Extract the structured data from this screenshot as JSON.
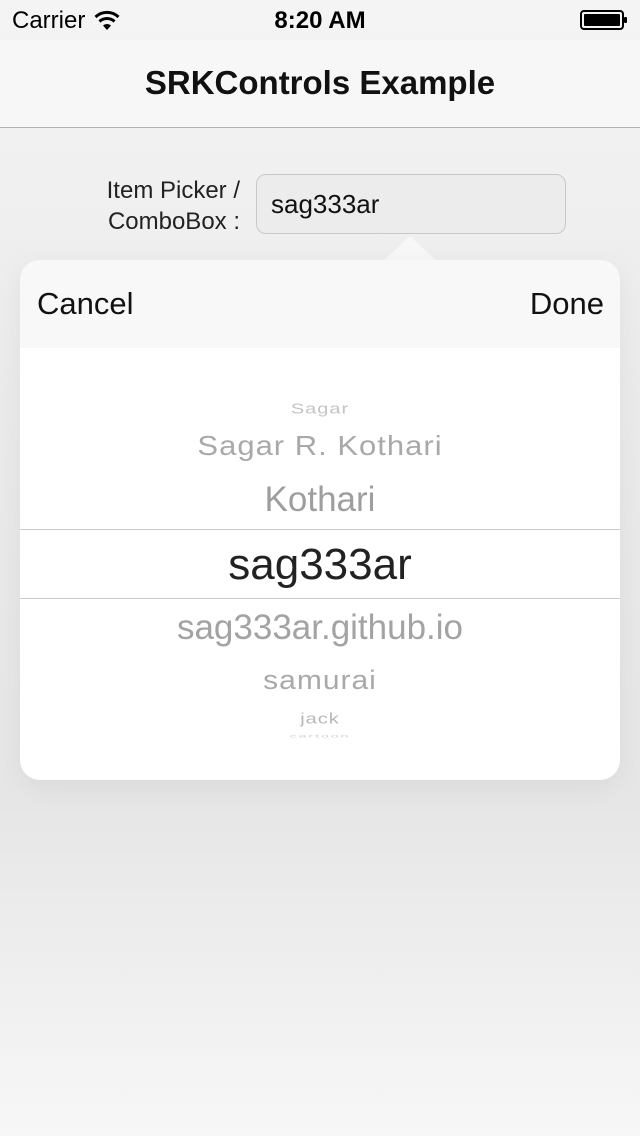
{
  "status_bar": {
    "carrier": "Carrier",
    "time": "8:20 AM",
    "icons": [
      "wifi-icon",
      "battery-icon"
    ]
  },
  "nav": {
    "title": "SRKControls Example"
  },
  "form": {
    "label_line1": "Item Picker /",
    "label_line2": "ComboBox :",
    "input_value": "sag333ar"
  },
  "popover": {
    "cancel_label": "Cancel",
    "done_label": "Done",
    "picker_items": [
      "Sagar",
      "Sagar R. Kothari",
      "Kothari",
      "sag333ar",
      "sag333ar.github.io",
      "samurai",
      "jack",
      "cartoon"
    ],
    "selected_value": "sag333ar"
  },
  "colors": {
    "background": "#ebebeb",
    "nav_background": "#f7f7f7",
    "popover_background": "#ffffff",
    "selected_text": "#222222",
    "unselected_text": "#a9a9a9"
  }
}
